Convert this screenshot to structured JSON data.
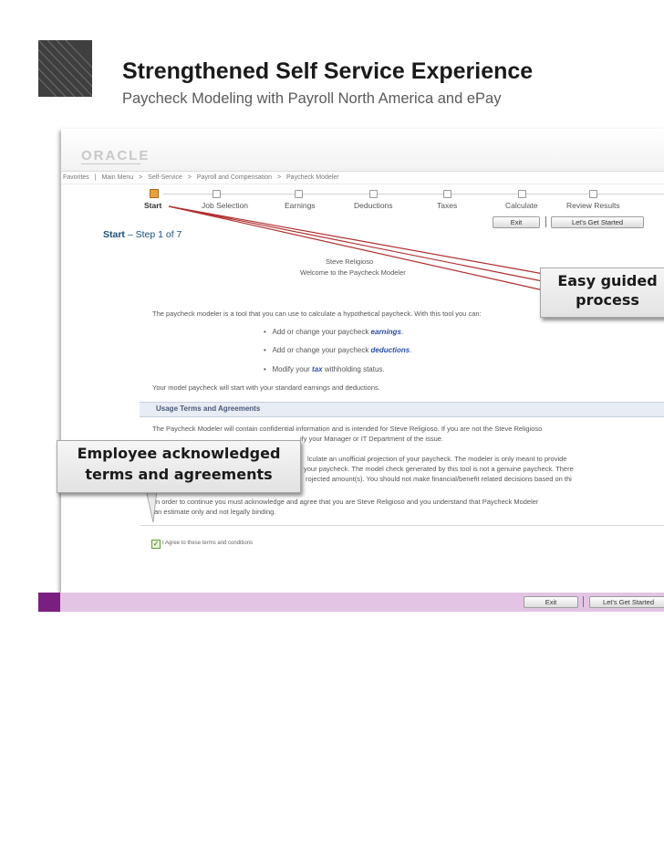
{
  "slide": {
    "title": "Strengthened Self Service Experience",
    "subtitle": "Paycheck Modeling with Payroll North America and ePay"
  },
  "app": {
    "logo": "ORACLE",
    "breadcrumb": [
      "Favorites",
      "|",
      "Main Menu",
      ">",
      "Self-Service",
      ">",
      "Payroll and Compensation",
      ">",
      "Paycheck Modeler"
    ],
    "steps": [
      "Start",
      "Job Selection",
      "Earnings",
      "Deductions",
      "Taxes",
      "Calculate",
      "Review Results"
    ],
    "buttons": {
      "exit": "Exit",
      "get_started": "Let's Get Started"
    },
    "start_title_bold": "Start",
    "start_title_rest": " – Step 1 of 7",
    "user_name": "Steve Religioso",
    "welcome": "Welcome to the Paycheck Modeler",
    "intro": "The paycheck modeler is a tool that you can use to calculate a hypothetical paycheck.  With this tool you can:",
    "bullets": [
      {
        "pre": "Add or change your paycheck ",
        "em": "earnings",
        "post": "."
      },
      {
        "pre": "Add or change your paycheck ",
        "em": "deductions",
        "post": "."
      },
      {
        "pre": "Modify your ",
        "em": "tax",
        "post": " withholding status."
      }
    ],
    "model_note": "Your model paycheck will start with your standard earnings and deductions.",
    "usage_title": "Usage Terms and Agreements",
    "terms_line1": "The Paycheck Modeler will contain confidential information and is intended for Steve Religioso. If you are not the Steve Religioso",
    "terms_line2": "ify your Manager or IT Department of the issue.",
    "terms_line3": "lculate an unofficial projection of your paycheck. The modeler is only meant to provide",
    "terms_line4": "your paycheck. The model check generated by this tool is not a genuine paycheck. There",
    "terms_line5": "rojected amount(s). You should not make financial/benefit related decisions based on thi",
    "terms_line6": "n order to continue you must acknowledge and agree that you are Steve Religioso and you understand that Paycheck Modeler",
    "terms_line7": "an estimate only and not legally binding.",
    "agree_label": "I Agree to these terms and conditions"
  },
  "callouts": {
    "guided": "Easy guided process",
    "employee": "Employee acknowledged terms and agreements"
  },
  "colors": {
    "purple_band": "#e4c4e4",
    "purple_accent": "#7a1f80",
    "link_blue": "#2a4fa8",
    "callout_line": "#b03030"
  }
}
